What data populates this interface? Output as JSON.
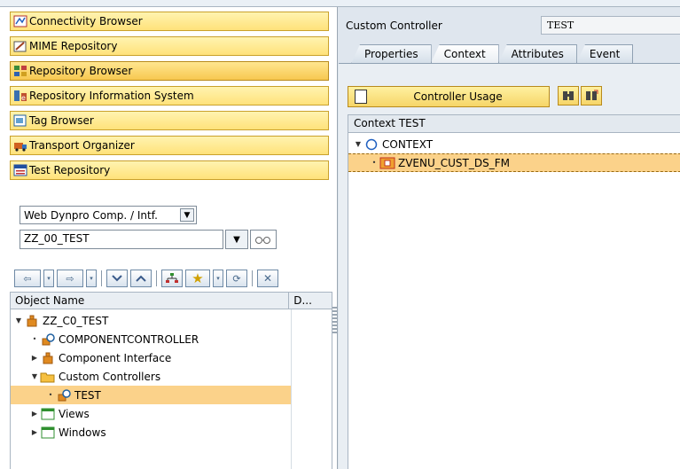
{
  "nav": {
    "items": [
      {
        "label": "Connectivity Browser",
        "icon": "connectivity-icon"
      },
      {
        "label": "MIME Repository",
        "icon": "mime-icon"
      },
      {
        "label": "Repository Browser",
        "icon": "repository-icon",
        "active": true
      },
      {
        "label": "Repository Information System",
        "icon": "info-system-icon"
      },
      {
        "label": "Tag Browser",
        "icon": "tag-icon"
      },
      {
        "label": "Transport Organizer",
        "icon": "transport-icon"
      },
      {
        "label": "Test Repository",
        "icon": "test-repo-icon"
      }
    ]
  },
  "object_select": {
    "type_value": "Web Dynpro Comp. / Intf.",
    "name_value": "ZZ_00_TEST"
  },
  "tree": {
    "columns": [
      "Object Name",
      "D..."
    ],
    "rows": [
      {
        "label": "ZZ_C0_TEST",
        "icon": "component-icon",
        "twisty": "expanded",
        "indent": 0
      },
      {
        "label": "COMPONENTCONTROLLER",
        "icon": "controller-icon",
        "twisty": "leaf",
        "indent": 1
      },
      {
        "label": "Component Interface",
        "icon": "component-icon",
        "twisty": "collapsed",
        "indent": 1
      },
      {
        "label": "Custom Controllers",
        "icon": "folder-icon",
        "twisty": "expanded",
        "indent": 1
      },
      {
        "label": "TEST",
        "icon": "custom-controller-icon",
        "twisty": "leaf",
        "indent": 2,
        "selected": true
      },
      {
        "label": "Views",
        "icon": "window-icon",
        "twisty": "collapsed",
        "indent": 1
      },
      {
        "label": "Windows",
        "icon": "window-icon",
        "twisty": "collapsed",
        "indent": 1
      }
    ]
  },
  "controller": {
    "label": "Custom Controller",
    "value": "TEST"
  },
  "tabs": [
    "Properties",
    "Context",
    "Attributes",
    "Event"
  ],
  "context": {
    "usage_button": "Controller Usage",
    "header": "Context TEST",
    "rows": [
      {
        "label": "CONTEXT",
        "icon": "context-node-icon",
        "twisty": "expanded"
      },
      {
        "label": "ZVENU_CUST_DS_FM",
        "icon": "context-element-icon",
        "twisty": "leaf",
        "selected": true
      }
    ]
  },
  "colors": {
    "nav_button": "#ffe27a",
    "selection": "#fbd28a",
    "panel": "#e9eef3"
  }
}
